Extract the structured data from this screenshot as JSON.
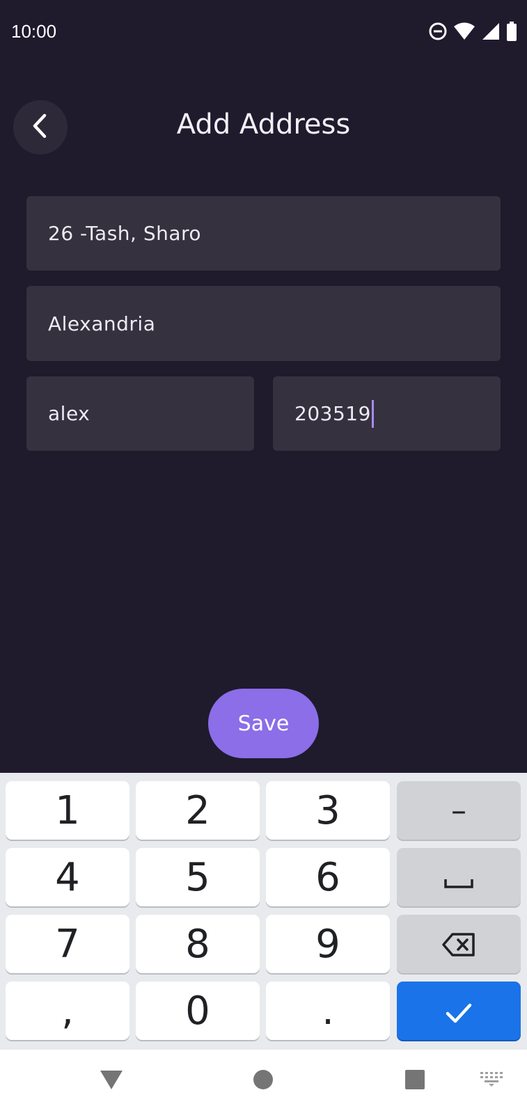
{
  "status_bar": {
    "time": "10:00",
    "icons": [
      "do-not-disturb-icon",
      "wifi-icon",
      "signal-icon",
      "battery-icon"
    ]
  },
  "header": {
    "title": "Add Address",
    "back_icon": "chevron-left-icon"
  },
  "form": {
    "street": {
      "value": "26 -Tash, Sharo"
    },
    "city": {
      "value": "Alexandria"
    },
    "state": {
      "value": "alex"
    },
    "zip": {
      "value": "203519"
    }
  },
  "save_button": {
    "label": "Save"
  },
  "keyboard": {
    "row1": [
      "1",
      "2",
      "3",
      "–"
    ],
    "row2": [
      "4",
      "5",
      "6",
      "space"
    ],
    "row3": [
      "7",
      "8",
      "9",
      "backspace"
    ],
    "row4": [
      ",",
      "0",
      ".",
      "done"
    ]
  },
  "navigation_bar": {
    "buttons": [
      "back-triangle-icon",
      "home-circle-icon",
      "recents-square-icon",
      "keyboard-switch-icon"
    ]
  },
  "colors": {
    "background": "#1f1b2d",
    "field_background": "#35313f",
    "accent": "#8b6ee8",
    "keyboard_done": "#1a73e8"
  }
}
